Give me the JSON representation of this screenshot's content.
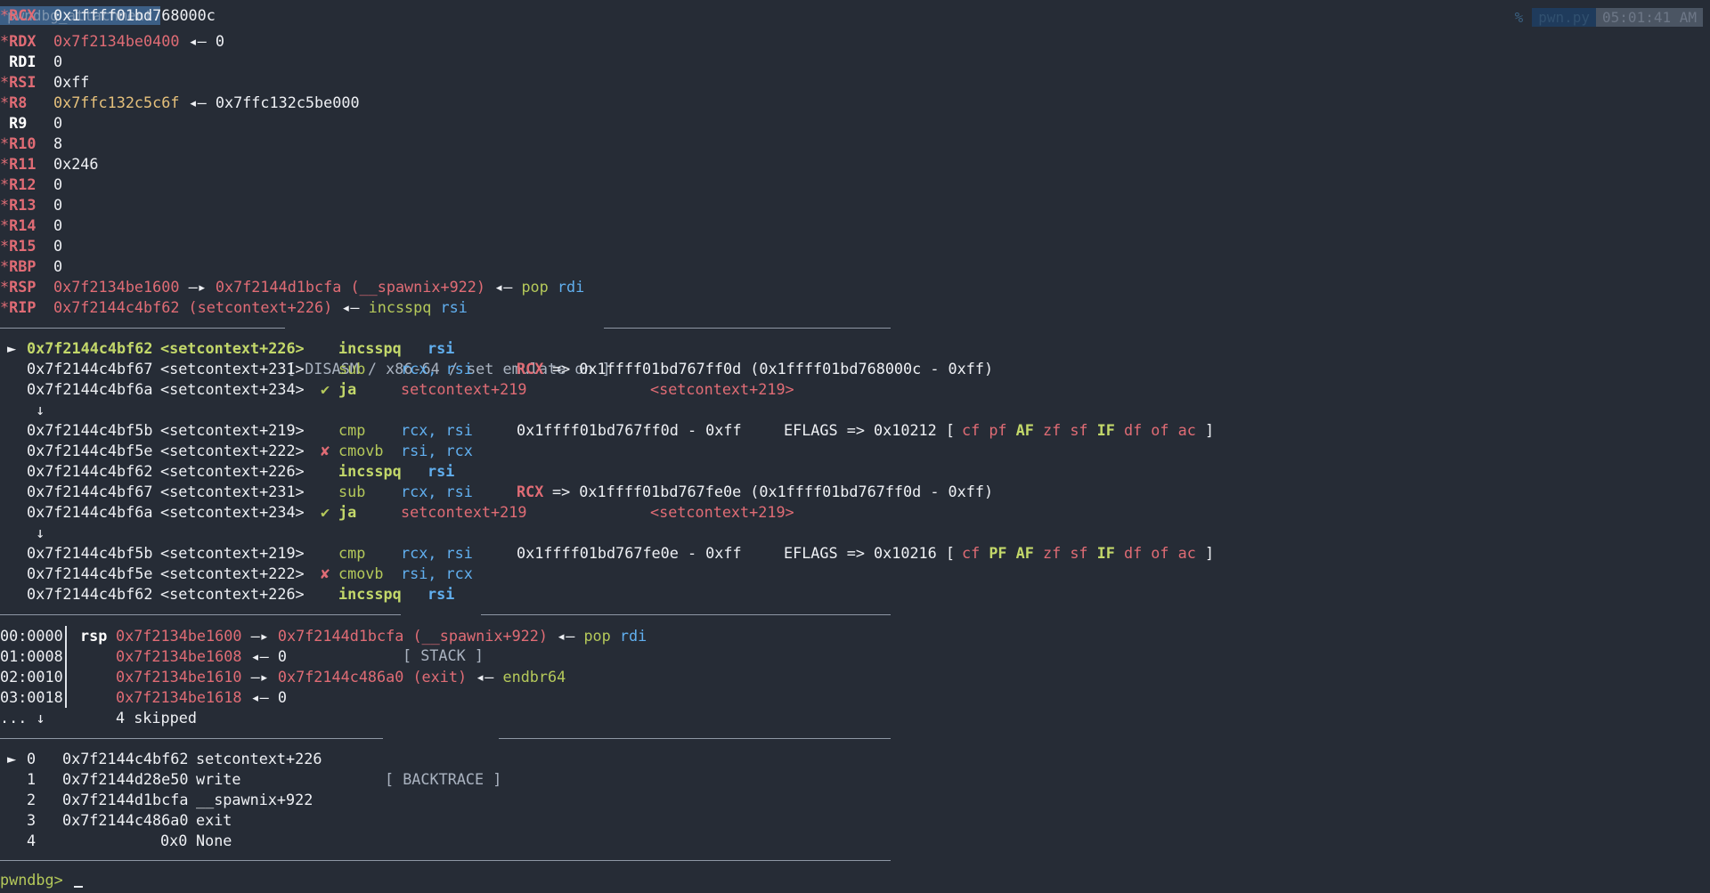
{
  "tmux": {
    "tab_label": "pwndbg_attachment",
    "flag": "%",
    "window": "pwn.py",
    "time": "05:01:41 AM"
  },
  "registers": [
    {
      "mark": "*",
      "name": "RCX",
      "value": "0x1ffff01bd768000c"
    },
    {
      "mark": "*",
      "name": "RDX",
      "value": "0x7f2134be0400",
      "arrow": "◂—",
      "deref": "0"
    },
    {
      "mark": " ",
      "name": "RDI",
      "value": "0"
    },
    {
      "mark": "*",
      "name": "RSI",
      "value": "0xff"
    },
    {
      "mark": "*",
      "name": "R8",
      "value": "0x7ffc132c5c6f",
      "arrow": "◂—",
      "deref": "0x7ffc132c5be000"
    },
    {
      "mark": " ",
      "name": "R9",
      "value": "0"
    },
    {
      "mark": "*",
      "name": "R10",
      "value": "8"
    },
    {
      "mark": "*",
      "name": "R11",
      "value": "0x246"
    },
    {
      "mark": "*",
      "name": "R12",
      "value": "0"
    },
    {
      "mark": "*",
      "name": "R13",
      "value": "0"
    },
    {
      "mark": "*",
      "name": "R14",
      "value": "0"
    },
    {
      "mark": "*",
      "name": "R15",
      "value": "0"
    },
    {
      "mark": "*",
      "name": "RBP",
      "value": "0"
    },
    {
      "mark": "*",
      "name": "RSP",
      "value": "0x7f2134be1600",
      "arrow1": "—▸",
      "target": "0x7f2144d1bcfa (__spawnix+922)",
      "arrow2": "◂—",
      "ins_mnem": "pop",
      "ins_op": "rdi"
    },
    {
      "mark": "*",
      "name": "RIP",
      "value": "0x7f2144c4bf62 (setcontext+226)",
      "arrow": "◂—",
      "ins_mnem": "incsspq",
      "ins_op": "rsi"
    }
  ],
  "sections": {
    "disasm": "[ DISASM / x86-64 / set emulate on ]",
    "stack": "[ STACK ]",
    "backtrace": "[ BACKTRACE ]"
  },
  "disasm": [
    {
      "cur": "►",
      "addr": "0x7f2144c4bf62",
      "sym": "<setcontext+226>",
      "flag": "",
      "mnem": "incsspq",
      "ops": "rsi"
    },
    {
      "addr": "0x7f2144c4bf67",
      "sym": "<setcontext+231>",
      "flag": "",
      "mnem": "sub",
      "ops": "rcx, rsi",
      "c_reg": "RCX",
      "c_rest": "=> 0x1ffff01bd767ff0d (0x1ffff01bd768000c - 0xff)"
    },
    {
      "addr": "0x7f2144c4bf6a",
      "sym": "<setcontext+234>",
      "flag": "✔",
      "mnem": "ja",
      "ops": "setcontext+219",
      "target": "<setcontext+219>"
    },
    {
      "jump": "↓"
    },
    {
      "addr": "0x7f2144c4bf5b",
      "sym": "<setcontext+219>",
      "flag": "",
      "mnem": "cmp",
      "ops": "rcx, rsi",
      "cmp_val": "0x1ffff01bd767ff0d - 0xff",
      "eflags": "EFLAGS => 0x10212 [",
      "flags": [
        "cf",
        "pf",
        "AF",
        "zf",
        "sf",
        "IF",
        "df",
        "of",
        "ac"
      ],
      "close": "]"
    },
    {
      "addr": "0x7f2144c4bf5e",
      "sym": "<setcontext+222>",
      "flag": "✘",
      "mnem": "cmovb",
      "ops": "rsi, rcx"
    },
    {
      "addr": "0x7f2144c4bf62",
      "sym": "<setcontext+226>",
      "flag": "",
      "mnem": "incsspq",
      "ops": "rsi"
    },
    {
      "addr": "0x7f2144c4bf67",
      "sym": "<setcontext+231>",
      "flag": "",
      "mnem": "sub",
      "ops": "rcx, rsi",
      "c_reg": "RCX",
      "c_rest": "=> 0x1ffff01bd767fe0e (0x1ffff01bd767ff0d - 0xff)"
    },
    {
      "addr": "0x7f2144c4bf6a",
      "sym": "<setcontext+234>",
      "flag": "✔",
      "mnem": "ja",
      "ops": "setcontext+219",
      "target": "<setcontext+219>"
    },
    {
      "jump": "↓"
    },
    {
      "addr": "0x7f2144c4bf5b",
      "sym": "<setcontext+219>",
      "flag": "",
      "mnem": "cmp",
      "ops": "rcx, rsi",
      "cmp_val": "0x1ffff01bd767fe0e - 0xff",
      "eflags": "EFLAGS => 0x10216 [",
      "flags": [
        "cf",
        "PF",
        "AF",
        "zf",
        "sf",
        "IF",
        "df",
        "of",
        "ac"
      ],
      "close": "]"
    },
    {
      "addr": "0x7f2144c4bf5e",
      "sym": "<setcontext+222>",
      "flag": "✘",
      "mnem": "cmovb",
      "ops": "rsi, rcx"
    },
    {
      "addr": "0x7f2144c4bf62",
      "sym": "<setcontext+226>",
      "flag": "",
      "mnem": "incsspq",
      "ops": "rsi"
    }
  ],
  "stack": [
    {
      "idx": "00:0000",
      "reg": "rsp",
      "addr": "0x7f2134be1600",
      "arrow1": "—▸",
      "target": "0x7f2144d1bcfa (__spawnix+922)",
      "arrow2": "◂—",
      "ins_mnem": "pop",
      "ins_op": "rdi"
    },
    {
      "idx": "01:0008",
      "reg": "",
      "addr": "0x7f2134be1608",
      "arrow2": "◂—",
      "val": "0"
    },
    {
      "idx": "02:0010",
      "reg": "",
      "addr": "0x7f2134be1610",
      "arrow1": "—▸",
      "target": "0x7f2144c486a0 (exit)",
      "arrow2": "◂—",
      "ins_mnem": "endbr64"
    },
    {
      "idx": "03:0018",
      "reg": "",
      "addr": "0x7f2134be1618",
      "arrow2": "◂—",
      "val": "0"
    },
    {
      "idx": "... ↓",
      "skipped": "4 skipped"
    }
  ],
  "backtrace": [
    {
      "cur": "►",
      "num": "0",
      "addr": "0x7f2144c4bf62",
      "sym": "setcontext+226"
    },
    {
      "cur": "",
      "num": "1",
      "addr": "0x7f2144d28e50",
      "sym": "write"
    },
    {
      "cur": "",
      "num": "2",
      "addr": "0x7f2144d1bcfa",
      "sym": "__spawnix+922"
    },
    {
      "cur": "",
      "num": "3",
      "addr": "0x7f2144c486a0",
      "sym": "exit"
    },
    {
      "cur": "",
      "num": "4",
      "addr": "0x0",
      "sym": "None"
    }
  ],
  "prompt": {
    "text": "pwndbg>"
  },
  "colors": {
    "background": "#262c36",
    "register_changed": "#e06c75",
    "pointer_yellow": "#e5c07b",
    "code_green": "#b5c95a",
    "reg_blue": "#61afef"
  }
}
